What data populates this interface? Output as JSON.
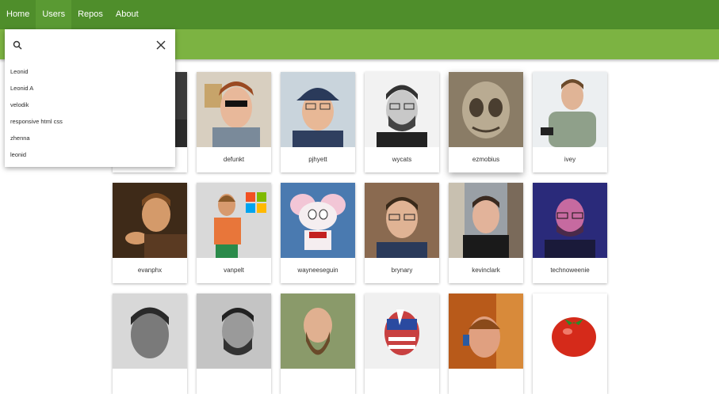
{
  "nav": {
    "items": [
      {
        "label": "Home",
        "active": false
      },
      {
        "label": "Users",
        "active": true
      },
      {
        "label": "Repos",
        "active": false
      },
      {
        "label": "About",
        "active": false
      }
    ]
  },
  "colors": {
    "nav_bg": "#4f8e2b",
    "subbar_bg": "#7cb342"
  },
  "search": {
    "value": "",
    "icon": "search-icon",
    "close_icon": "close-icon",
    "suggestions": [
      "Leonid",
      "Leonid A",
      "velodik",
      "responsive html css",
      "zhenna",
      "leonid"
    ]
  },
  "users": [
    {
      "login": "",
      "icon": "avatar"
    },
    {
      "login": "defunkt",
      "icon": "avatar"
    },
    {
      "login": "pjhyett",
      "icon": "avatar"
    },
    {
      "login": "wycats",
      "icon": "avatar"
    },
    {
      "login": "ezmobius",
      "icon": "avatar"
    },
    {
      "login": "ivey",
      "icon": "avatar"
    },
    {
      "login": "evanphx",
      "icon": "avatar"
    },
    {
      "login": "vanpelt",
      "icon": "avatar"
    },
    {
      "login": "wayneeseguin",
      "icon": "avatar"
    },
    {
      "login": "brynary",
      "icon": "avatar"
    },
    {
      "login": "kevinclark",
      "icon": "avatar"
    },
    {
      "login": "technoweenie",
      "icon": "avatar"
    },
    {
      "login": "",
      "icon": "avatar"
    },
    {
      "login": "",
      "icon": "avatar"
    },
    {
      "login": "",
      "icon": "avatar"
    },
    {
      "login": "",
      "icon": "avatar"
    },
    {
      "login": "",
      "icon": "avatar"
    },
    {
      "login": "",
      "icon": "avatar"
    }
  ]
}
